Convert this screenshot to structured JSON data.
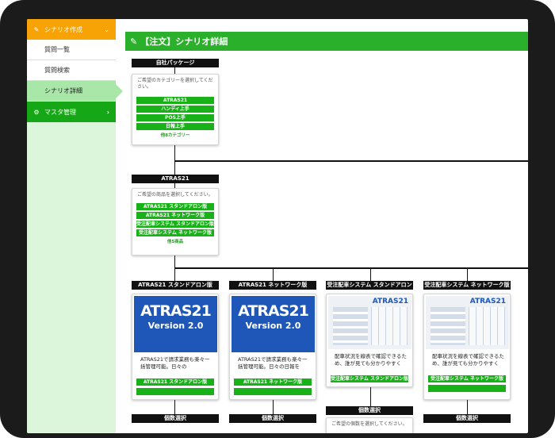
{
  "sidebar": {
    "header": {
      "label": "シナリオ作成",
      "icon": "pencil-icon"
    },
    "items": [
      {
        "label": "質問一覧"
      },
      {
        "label": "質問検索"
      },
      {
        "label": "シナリオ詳細",
        "active": true
      }
    ],
    "master": {
      "label": "マスタ管理",
      "icon": "gear-icon"
    }
  },
  "title": "【注文】シナリオ詳細",
  "level1": {
    "header": "自社パッケージ",
    "prompt": "ご希望のカテゴリーを選択してください。",
    "options": [
      "ATRAS21",
      "ハンディ上手",
      "POS上手",
      "日報上手"
    ],
    "more": "他8カテゴリー"
  },
  "level2": {
    "header": "ATRAS21",
    "prompt": "ご希望の商品を選択してください。",
    "options": [
      "ATRAS21 スタンドアロン版",
      "ATRAS21 ネットワーク版",
      "受注配車システム スタンドアロン版",
      "受注配車システム ネットワーク版"
    ],
    "more": "他5商品"
  },
  "products": [
    {
      "header": "ATRAS21 スタンドアロン版",
      "img_title": "ATRAS21",
      "img_sub": "Version 2.0",
      "desc": "ATRAS21で請求業務も楽々一括管理可能。日々の",
      "button": "ATRAS21 スタンドアロン版",
      "footer": "個数選択"
    },
    {
      "header": "ATRAS21 ネットワーク版",
      "img_title": "ATRAS21",
      "img_sub": "Version 2.0",
      "desc": "ATRAS21で請求業務も楽々一括管理可能。日々の日報を",
      "button": "ATRAS21 ネットワーク版",
      "footer": "個数選択"
    },
    {
      "header": "受注配車システム スタンドアロン版",
      "img_title": "ATRAS21",
      "desc": "配車状況を線表で確認できるため、誰が見ても分かりやすく",
      "button": "受注配車システム スタンドアロン版",
      "footer": "個数選択",
      "footer_prompt": "ご希望の個数を選択してください。"
    },
    {
      "header": "受注配車システム ネットワーク版",
      "img_title": "ATRAS21",
      "desc": "配車状況を線表で確認できるため、誰が見ても分かりやすく",
      "button": "受注配車システム ネットワーク版",
      "footer": "個数選択"
    }
  ],
  "colors": {
    "accent_green": "#18b218",
    "orange": "#f7a305",
    "sidebar_bg": "#dcf6dc",
    "product_blue": "#1e57b8"
  }
}
